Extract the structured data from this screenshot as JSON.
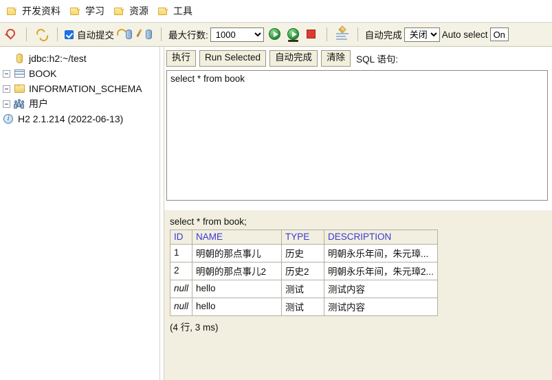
{
  "bookmarks": [
    {
      "icon": "folder-icon",
      "label": "开发资料"
    },
    {
      "icon": "folder-icon",
      "label": "学习"
    },
    {
      "icon": "folder-icon",
      "label": "资源"
    },
    {
      "icon": "folder-icon",
      "label": "工具"
    }
  ],
  "toolbar": {
    "icons": {
      "disconnect": "pin-icon",
      "refresh": "refresh-icon",
      "commit": "commit-db-icon",
      "rollback": "rollback-db-icon",
      "run": "run-icon",
      "run_selected": "run-selected-icon",
      "stop": "stop-icon",
      "sort": "sort-icon"
    },
    "autocommit_label": "自动提交",
    "autocommit_checked": true,
    "max_rows_label": "最大行数:",
    "max_rows_value": "1000",
    "max_rows_options": [
      "1000"
    ],
    "autocomplete_label": "自动完成",
    "autocomplete_value": "关闭",
    "autocomplete_options": [
      "关闭"
    ],
    "auto_select_label": "Auto select",
    "auto_select_value": "On"
  },
  "sidebar": {
    "items": [
      {
        "label": "jdbc:h2:~/test",
        "icon": "database-cylinder-icon",
        "expandable": false
      },
      {
        "label": "BOOK",
        "icon": "table-icon",
        "expandable": true
      },
      {
        "label": "INFORMATION_SCHEMA",
        "icon": "folder-icon",
        "expandable": true
      },
      {
        "label": "用户",
        "icon": "users-icon",
        "expandable": true
      },
      {
        "label": "H2 2.1.214 (2022-06-13)",
        "icon": "info-icon",
        "expandable": false
      }
    ]
  },
  "sql_panel": {
    "buttons": {
      "run": "执行",
      "run_selected": "Run Selected",
      "autocomplete": "自动完成",
      "clear": "清除"
    },
    "label": "SQL 语句:",
    "editor_value": "select * from book"
  },
  "results": {
    "query": "select * from book;",
    "columns": [
      "ID",
      "NAME",
      "TYPE",
      "DESCRIPTION"
    ],
    "rows": [
      {
        "ID": "1",
        "NAME": "明朝的那点事儿",
        "TYPE": "历史",
        "DESCRIPTION": "明朝永乐年间，朱元璋...",
        "id_null": false
      },
      {
        "ID": "2",
        "NAME": "明朝的那点事儿2",
        "TYPE": "历史2",
        "DESCRIPTION": "明朝永乐年间，朱元璋2...",
        "id_null": false
      },
      {
        "ID": "null",
        "NAME": "hello",
        "TYPE": "测试",
        "DESCRIPTION": "测试内容",
        "id_null": true
      },
      {
        "ID": "null",
        "NAME": "hello",
        "TYPE": "测试",
        "DESCRIPTION": "测试内容",
        "id_null": true
      }
    ],
    "status": "(4 行, 3 ms)"
  },
  "colors": {
    "toolbar_bg": "#f4f2e4",
    "results_bg": "#f2efe0",
    "header_text": "#3b37d6",
    "accent_checkbox": "#1a73e8"
  }
}
